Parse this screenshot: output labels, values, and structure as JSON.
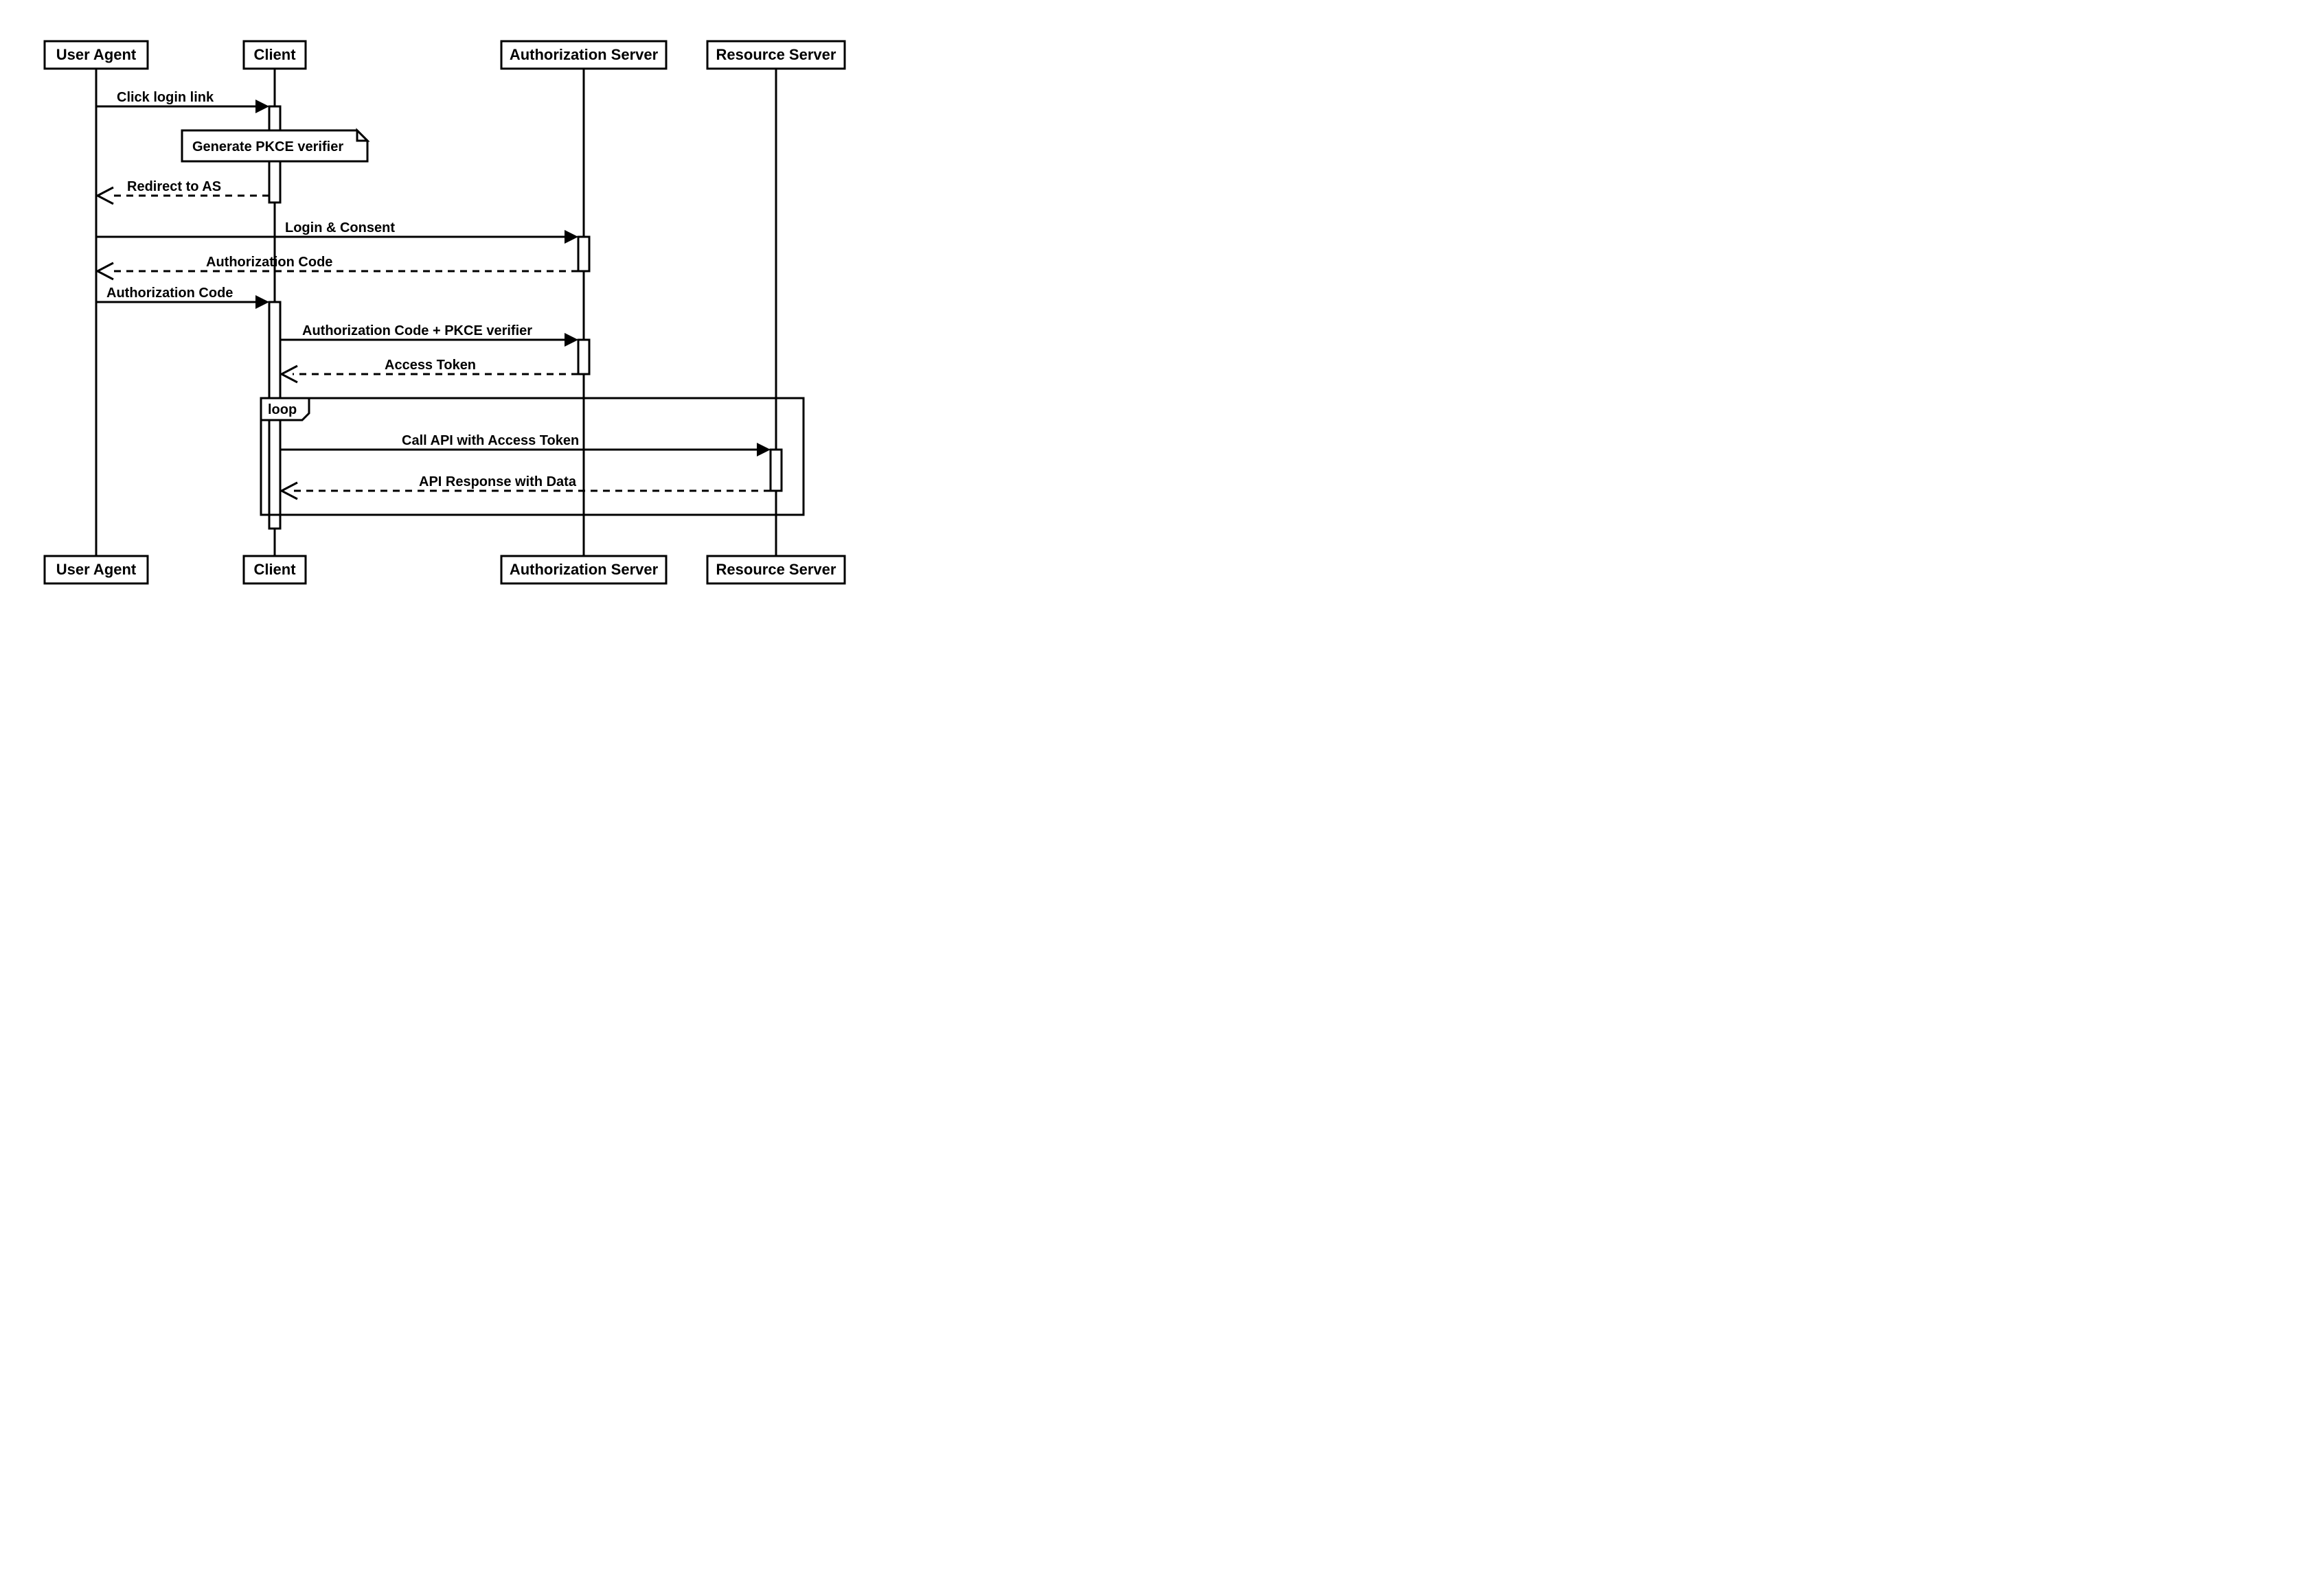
{
  "participants": {
    "user_agent": "User Agent",
    "client": "Client",
    "auth_server": "Authorization Server",
    "resource_server": "Resource Server"
  },
  "messages": {
    "click_login": "Click login link",
    "generate_pkce": "Generate PKCE verifier",
    "redirect_as": "Redirect to AS",
    "login_consent": "Login & Consent",
    "auth_code_return": "Authorization Code",
    "auth_code_fwd": "Authorization Code",
    "code_plus_pkce": "Authorization Code + PKCE verifier",
    "access_token": "Access Token",
    "call_api": "Call API with Access Token",
    "api_response": "API Response with Data"
  },
  "fragments": {
    "loop": "loop"
  }
}
